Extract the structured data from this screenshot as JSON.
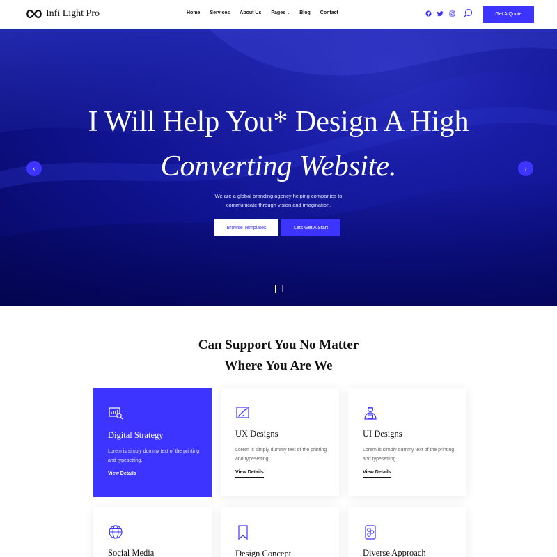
{
  "brand": {
    "name": "Infi Light Pro",
    "accent": "#3d35ff",
    "hero_bg": "#0f138f"
  },
  "nav": {
    "items": [
      "Home",
      "Services",
      "About Us",
      "Pages",
      "Blog",
      "Contact"
    ],
    "pages_caret": "⌄"
  },
  "header": {
    "social_icons": [
      "facebook-icon",
      "twitter-icon",
      "instagram-icon"
    ],
    "quote_label": "Get A Quote"
  },
  "hero": {
    "title_line1": "I Will Help You* Design A High",
    "title_line2": "Converting Website.",
    "subtitle": "We are a global branding agency helping companies to communicate through vision and imagination.",
    "browse_label": "Browse Templates",
    "start_label": "Lets Get A Start",
    "prev_arrow": "‹",
    "next_arrow": "›",
    "slide_count": 2,
    "active_slide": 1
  },
  "support": {
    "title_line1": "Can Support You No Matter",
    "title_line2": "Where You Are We",
    "cards": [
      {
        "title": "Digital Strategy",
        "text": "Lorem is simply dummy text of the printing and typesetting.",
        "link": "View Details",
        "icon": "strategy-chart-icon",
        "active": true
      },
      {
        "title": "UX Designs",
        "text": "Lorem is simply dummy text of the printing and typesetting.",
        "link": "View Details",
        "icon": "design-pen-icon",
        "active": false
      },
      {
        "title": "UI Designs",
        "text": "Lorem is simply dummy text of the printing and typesetting.",
        "link": "View Details",
        "icon": "designer-person-icon",
        "active": false
      },
      {
        "title": "Social Media",
        "icon": "globe-icon"
      },
      {
        "title": "Design Concept",
        "icon": "bookmark-icon"
      },
      {
        "title": "Diverse Approach",
        "icon": "approach-icon"
      }
    ]
  }
}
